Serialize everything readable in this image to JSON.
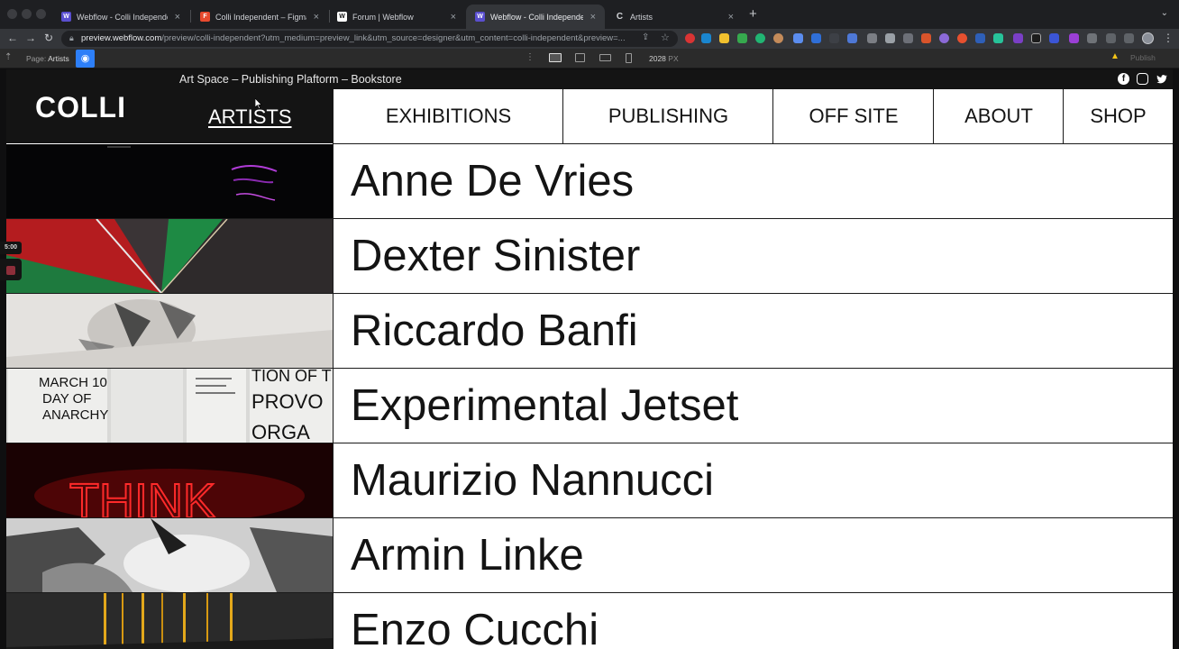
{
  "browser": {
    "tabs": [
      {
        "title": "Webflow - Colli Independent",
        "favicon": "webflow-icon",
        "color": "#5a4fcf",
        "glyph": "W"
      },
      {
        "title": "Colli Independent – Figma",
        "favicon": "figma-icon",
        "color": "#e84a2e",
        "glyph": "F"
      },
      {
        "title": "Forum | Webflow",
        "favicon": "webflow-forum-icon",
        "color": "#ffffff",
        "glyph": "W"
      },
      {
        "title": "Webflow - Colli Independent",
        "favicon": "webflow-icon",
        "color": "#5a4fcf",
        "glyph": "W"
      },
      {
        "title": "Artists",
        "favicon": "loading-icon",
        "color": "#34363a",
        "glyph": "C"
      }
    ],
    "new_tab_glyph": "+",
    "tab_menu_glyph": "⌄",
    "close_glyph": "×",
    "url_host": "preview.webflow.com",
    "url_rest": "/preview/colli-independent?utm_medium=preview_link&utm_source=designer&utm_content=colli-independent&preview=..."
  },
  "webflow_bar": {
    "page_label": "Page:",
    "page_name": "Artists",
    "width_value": "2028",
    "width_unit": "PX",
    "publish_label": "Publish"
  },
  "recorder": {
    "timer": "5:00"
  },
  "site": {
    "tagline": "Art Space – Publishing Plaftorm – Bookstore",
    "logo": "COLLI",
    "nav": {
      "artists": "ARTISTS",
      "exhibitions": "EXHIBITIONS",
      "publishing": "PUBLISHING",
      "off_site": "OFF SITE",
      "about": "ABOUT",
      "shop": "SHOP"
    },
    "social": {
      "facebook": "f",
      "instagram": "",
      "twitter": "t"
    },
    "artists": [
      "Anne De Vries",
      "Dexter Sinister",
      "Riccardo Banfi",
      "Experimental Jetset",
      "Maurizio Nannucci",
      "Armin Linke",
      "Enzo Cucchi"
    ],
    "thumb_text": {
      "jetset_left": "MARCH 10 DAY OF ANARCHY",
      "jetset_right": "TION OF THE PROVO ORGA",
      "nannucci": "THINK"
    }
  }
}
